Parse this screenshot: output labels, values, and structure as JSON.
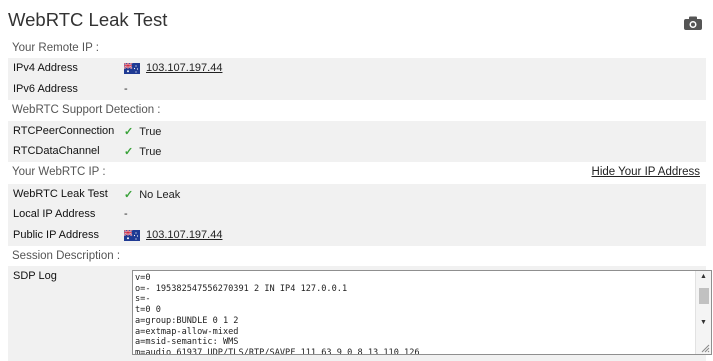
{
  "page": {
    "title": "WebRTC Leak Test",
    "camera_icon": "camera-icon"
  },
  "remote_ip": {
    "heading": "Your Remote IP :",
    "rows": [
      {
        "label": "IPv4 Address",
        "value": "103.107.197.44",
        "flag": "australia-flag"
      },
      {
        "label": "IPv6 Address",
        "value": "-"
      }
    ]
  },
  "support": {
    "heading": "WebRTC Support Detection :",
    "rows": [
      {
        "label": "RTCPeerConnection",
        "value": "True",
        "check": "✓"
      },
      {
        "label": "RTCDataChannel",
        "value": "True",
        "check": "✓"
      }
    ]
  },
  "webrtc_ip": {
    "heading": "Your WebRTC IP :",
    "hide_link": "Hide Your IP Address",
    "rows": [
      {
        "label": "WebRTC Leak Test",
        "value": "No Leak",
        "check": "✓"
      },
      {
        "label": "Local IP Address",
        "value": "-"
      },
      {
        "label": "Public IP Address",
        "value": "103.107.197.44",
        "flag": "australia-flag"
      }
    ]
  },
  "session": {
    "heading": "Session Description :",
    "sdp_label": "SDP Log",
    "sdp_lines": [
      "v=0",
      "o=- 195382547556270391 2 IN IP4 127.0.0.1",
      "s=-",
      "t=0 0",
      "a=group:BUNDLE 0 1 2",
      "a=extmap-allow-mixed",
      "a=msid-semantic: WMS",
      "m=audio 61937 UDP/TLS/RTP/SAVPF 111 63 9 0 8 13 110 126"
    ]
  },
  "colors": {
    "row_bg": "#f1f1f1",
    "check_green": "#3aa23a",
    "flag_blue": "#1f3a93"
  }
}
